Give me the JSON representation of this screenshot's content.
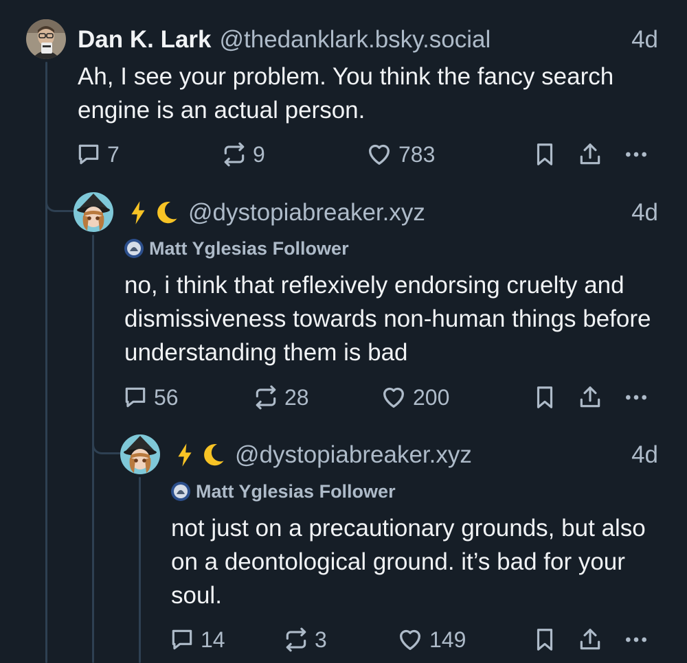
{
  "posts": [
    {
      "display_name": "Dan K. Lark",
      "handle": "@thedanklark.bsky.social",
      "time": "4d",
      "text": "Ah, I see your problem. You think the fancy search engine is an actual person.",
      "replies": "7",
      "reposts": "9",
      "likes": "783"
    },
    {
      "display_name": "",
      "handle": "@dystopiabreaker.xyz",
      "time": "4d",
      "label": "Matt Yglesias Follower",
      "text": "no, i think that reflexively endorsing cruelty and dismissiveness towards non-human things before understanding them is bad",
      "replies": "56",
      "reposts": "28",
      "likes": "200"
    },
    {
      "display_name": "",
      "handle": "@dystopiabreaker.xyz",
      "time": "4d",
      "label": "Matt Yglesias Follower",
      "text": "not just on a precautionary grounds, but also on a deontological ground. it’s bad for your soul.",
      "replies": "14",
      "reposts": "3",
      "likes": "149"
    }
  ],
  "icons": {
    "reply": "speech-bubble-icon",
    "repost": "repost-arrows-icon",
    "like": "heart-icon",
    "bookmark": "bookmark-icon",
    "share": "share-upload-icon",
    "more": "ellipsis-icon",
    "name_emoji": [
      "lightning-bolt-emoji",
      "crescent-moon-emoji"
    ]
  },
  "colors": {
    "background": "#161e27",
    "text_primary": "#f1f3f5",
    "text_secondary": "#aebbc9",
    "thread_line": "#2e4052",
    "lightning": "#f7c325",
    "moon": "#f7c325"
  }
}
